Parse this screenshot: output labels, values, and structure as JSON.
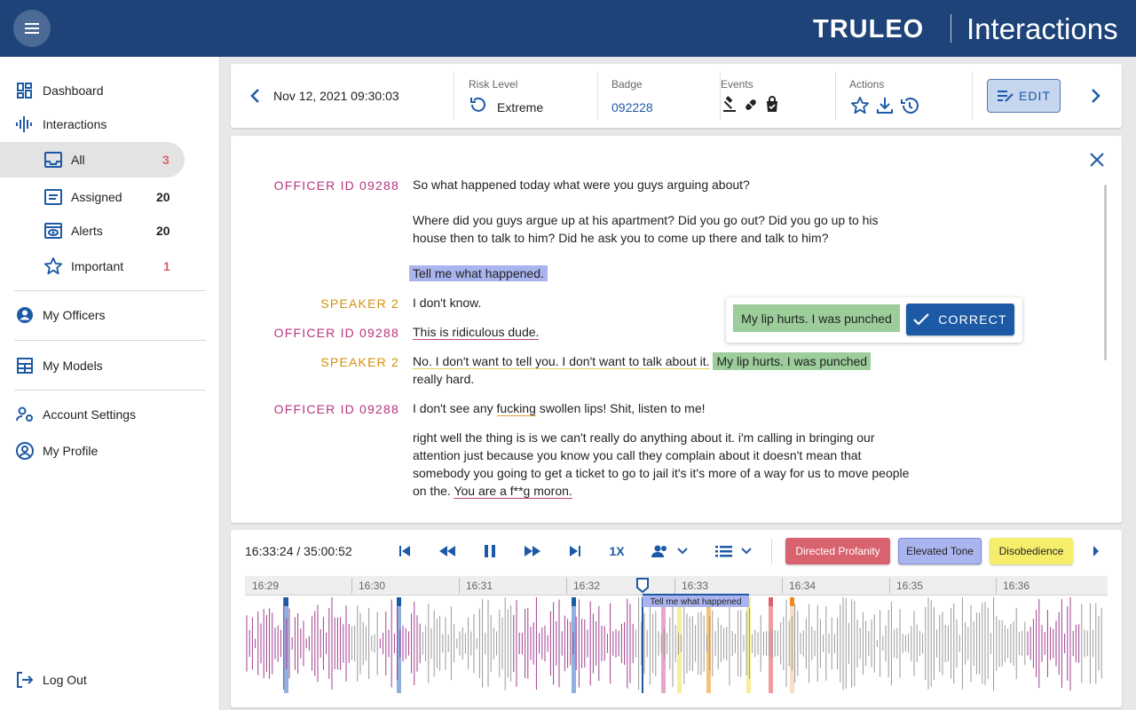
{
  "topbar": {
    "logo_text": "TRULEO",
    "app_title": "Interactions",
    "brand_color": "#1d4379"
  },
  "sidebar": {
    "dashboard": "Dashboard",
    "interactions": "Interactions",
    "all": {
      "label": "All",
      "count": "3"
    },
    "assigned": {
      "label": "Assigned",
      "count": "20"
    },
    "alerts": {
      "label": "Alerts",
      "count": "20"
    },
    "important": {
      "label": "Important",
      "count": "1"
    },
    "my_officers": "My Officers",
    "my_models": "My Models",
    "account_settings": "Account Settings",
    "my_profile": "My Profile",
    "log_out": "Log Out"
  },
  "header": {
    "datetime": "Nov 12, 2021 09:30:03",
    "risk_label": "Risk Level",
    "risk_value": "Extreme",
    "badge_label": "Badge",
    "badge_value": "092228",
    "events_label": "Events",
    "actions_label": "Actions",
    "edit_label": "EDIT"
  },
  "transcript": {
    "officer_label": "OFFICER ID 09288",
    "speaker2_label": "SPEAKER 2",
    "l1": "So what happened today what were you guys arguing about?",
    "l2": "Where did you guys argue up at his apartment? Did you go out? Did you go up to his house then to talk to him? Did he ask you to come up there and talk to him?",
    "l3": "Tell me what happened.",
    "l4": "I don't know.",
    "l5": "This is ridiculous dude.",
    "l6a": "No. I don't want to tell you. I don't want to talk about it.",
    "l6b": "My lip hurts. I was punched",
    "l6c": "really hard.",
    "l7a": "I don't see any ",
    "l7b": "fucking",
    "l7c": " swollen lips! Shit, listen to me!",
    "l8a": "right well the thing is is we can't really do anything about it. i'm calling in bringing our attention just because you know you call they complain about it doesn't mean that somebody you going to get a ticket to go to jail it's it's more of a way for us to move people on the. ",
    "l8b": "You are a f**g moron.",
    "popup_text": "My lip hurts. I was punched",
    "correct_label": "CORRECT"
  },
  "player": {
    "time": "16:33:24 / 35:00:52",
    "speed": "1X",
    "chips": [
      "Directed Profanity",
      "Elevated Tone",
      "Disobedience"
    ],
    "chip_colors": [
      "#d8626d",
      "#aab4ef",
      "#f6ee6b"
    ],
    "ticks": [
      "16:29",
      "16:30",
      "16:31",
      "16:32",
      "16:33",
      "16:34",
      "16:35",
      "16:36"
    ],
    "segment_label": "Tell me what happened"
  }
}
